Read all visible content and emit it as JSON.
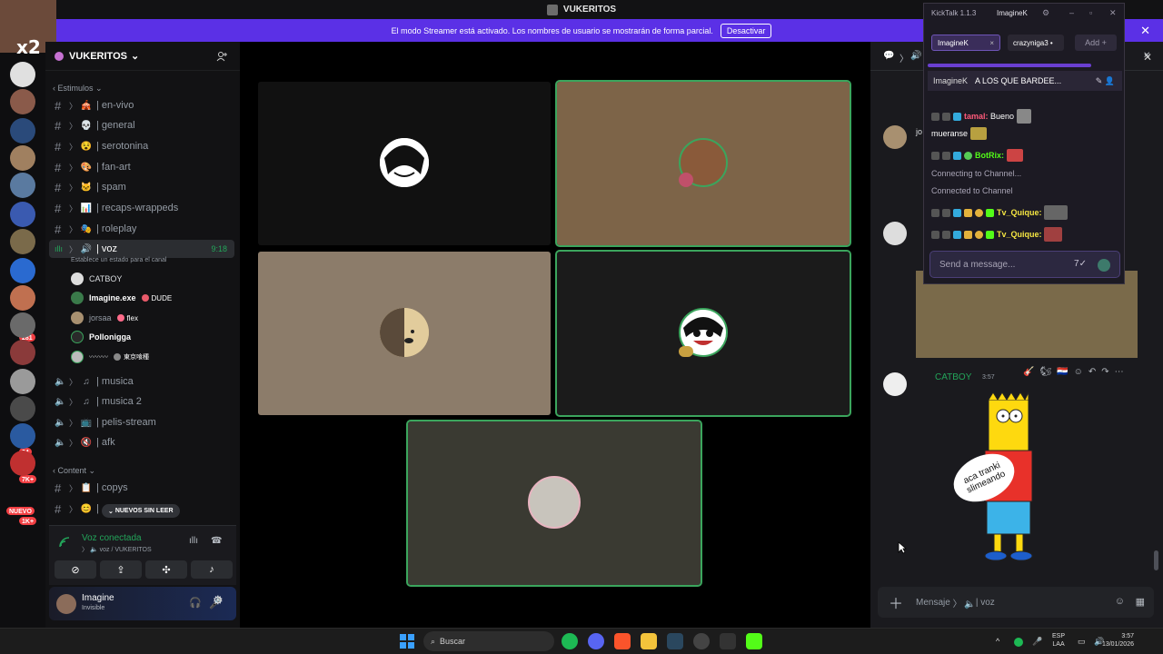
{
  "window": {
    "title": "VUKERITOS"
  },
  "banner": {
    "text": "El modo Streamer está activado. Los nombres de usuario se mostrarán de forma parcial.",
    "button": "Desactivar",
    "close": "✕"
  },
  "rail": {
    "multiplier": "x2",
    "badges": [
      "281",
      "24",
      "7K+",
      "NUEVO",
      "1K+"
    ]
  },
  "server": {
    "name": "VUKERITOS",
    "chevron": "⌄"
  },
  "categories": {
    "estimulos": "Estimulos",
    "content": "Content"
  },
  "channels": [
    {
      "name": "| en-vivo",
      "emoji": "🎪"
    },
    {
      "name": "| general",
      "emoji": "💀"
    },
    {
      "name": "| serotonina",
      "emoji": "😵"
    },
    {
      "name": "| fan-art",
      "emoji": "🎨"
    },
    {
      "name": "| spam",
      "emoji": "🐱"
    },
    {
      "name": "| recaps-wrappeds",
      "emoji": "📊"
    },
    {
      "name": "| roleplay",
      "emoji": "🎭"
    }
  ],
  "voice_channel": {
    "name": "| voz",
    "time": "9:18",
    "status_hint": "Establece un estado para el canal"
  },
  "voice_users": [
    {
      "name": "CATBOY",
      "tag": ""
    },
    {
      "name": "Imagine.exe",
      "tag": "DUDE"
    },
    {
      "name": "jorsaa",
      "tag": "flex"
    },
    {
      "name": "Pollonigga",
      "tag": ""
    },
    {
      "name": "〰〰〰",
      "tag": "東京喰種"
    }
  ],
  "other_voice": [
    {
      "name": "| musica"
    },
    {
      "name": "| musica 2"
    },
    {
      "name": "| pelis-stream"
    },
    {
      "name": "| afk"
    }
  ],
  "content_channels": [
    {
      "name": "| copys"
    }
  ],
  "unread_pill": "NUEVOS SIN LEER",
  "voice_panel": {
    "status": "Voz conectada",
    "location": "voz / VUKERITOS"
  },
  "user_panel": {
    "name": "Imagine",
    "status": "Invisible"
  },
  "chat": {
    "author": "CATBOY",
    "time": "3:57",
    "truncated_author": "jo",
    "sticker_text": "aca tranki slimeando",
    "input_prefix": "Mensaje",
    "input_channel": "| voz"
  },
  "kicktalk": {
    "title": "KickTalk 1.1.3",
    "user": "ImagineK",
    "tabs": [
      "ImagineK",
      "crazyniga3"
    ],
    "add": "Add +",
    "pinned_user": "ImagineK",
    "pinned_msg": "A LOS QUE BARDEE...",
    "lines": [
      {
        "user": "tamal:",
        "msg": "Bueno"
      },
      {
        "user": "",
        "msg": "mueranse"
      },
      {
        "user": "BotRix:",
        "msg": ""
      },
      {
        "user": "",
        "msg": "Connecting to Channel..."
      },
      {
        "user": "",
        "msg": "Connected to Channel"
      },
      {
        "user": "Tv_Quique:",
        "msg": ""
      },
      {
        "user": "Tv_Quique:",
        "msg": ""
      }
    ],
    "input_placeholder": "Send a message..."
  },
  "taskbar": {
    "search": "Buscar",
    "lang1": "ESP",
    "lang2": "LAA",
    "time": "3:57",
    "date": "13/01/2026"
  }
}
